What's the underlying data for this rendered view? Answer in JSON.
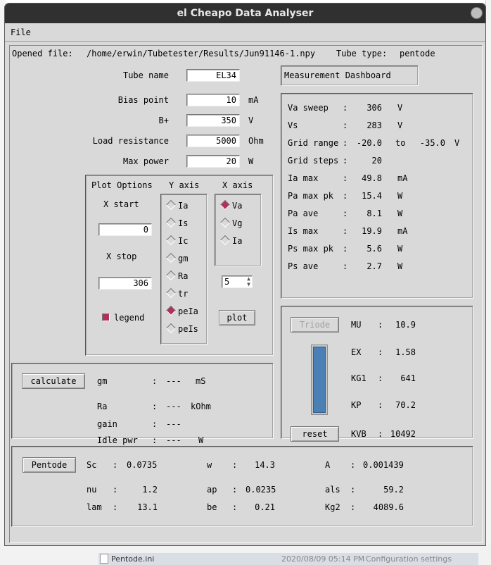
{
  "window": {
    "title": "el Cheapo Data Analyser"
  },
  "menu": {
    "file": "File"
  },
  "header": {
    "opened_label": "Opened file:",
    "opened_path": "/home/erwin/Tubetester/Results/Jun91146-1.npy",
    "tube_type_label": "Tube type:",
    "tube_type": "pentode"
  },
  "params": {
    "tube_name": {
      "label": "Tube name",
      "value": "EL34"
    },
    "bias_point": {
      "label": "Bias point",
      "value": "10",
      "unit": "mA"
    },
    "b_plus": {
      "label": "B+",
      "value": "350",
      "unit": "V"
    },
    "load_resistance": {
      "label": "Load resistance",
      "value": "5000",
      "unit": "Ohm"
    },
    "max_power": {
      "label": "Max power",
      "value": "20",
      "unit": "W"
    }
  },
  "plot_options": {
    "title": "Plot Options",
    "x_start_label": "X start",
    "x_start": "0",
    "x_stop_label": "X stop",
    "x_stop": "306",
    "legend_label": "legend",
    "legend_checked": true,
    "y_axis_label": "Y axis",
    "y_axis_options": [
      "Ia",
      "Is",
      "Ic",
      "gm",
      "Ra",
      "tr",
      "peIa",
      "peIs"
    ],
    "y_axis_selected": "peIa",
    "x_axis_label": "X axis",
    "x_axis_options": [
      "Va",
      "Vg",
      "Ia"
    ],
    "x_axis_selected": "Va",
    "spin_value": "5",
    "plot_button": "plot"
  },
  "dashboard": {
    "title": "Measurement Dashboard",
    "rows": [
      {
        "name": "Va sweep",
        "value": "306",
        "unit": "V"
      },
      {
        "name": "Vs",
        "value": "283",
        "unit": "V"
      },
      {
        "name": "Grid range",
        "value": "-20.0",
        "to": "to",
        "value2": "-35.0",
        "unit": "V"
      },
      {
        "name": "Grid steps",
        "value": "20",
        "unit": ""
      },
      {
        "name": "Ia max",
        "value": "49.8",
        "unit": "mA"
      },
      {
        "name": "Pa max pk",
        "value": "15.4",
        "unit": "W"
      },
      {
        "name": "Pa ave",
        "value": "8.1",
        "unit": "W"
      },
      {
        "name": "Is max",
        "value": "19.9",
        "unit": "mA"
      },
      {
        "name": "Ps max pk",
        "value": "5.6",
        "unit": "W"
      },
      {
        "name": "Ps ave",
        "value": "2.7",
        "unit": "W"
      }
    ]
  },
  "calc": {
    "button": "calculate",
    "rows": [
      {
        "name": "gm",
        "value": "---",
        "unit": "mS"
      },
      {
        "name": "Ra",
        "value": "---",
        "unit": "kOhm"
      },
      {
        "name": "gain",
        "value": "---",
        "unit": ""
      },
      {
        "name": "Idle pwr",
        "value": "---",
        "unit": "W"
      }
    ]
  },
  "triode": {
    "button": "Triode",
    "reset_button": "reset",
    "rows": [
      {
        "name": "MU",
        "value": "10.9"
      },
      {
        "name": "EX",
        "value": "1.58"
      },
      {
        "name": "KG1",
        "value": "641"
      },
      {
        "name": "KP",
        "value": "70.2"
      },
      {
        "name": "KVB",
        "value": "10492"
      }
    ]
  },
  "pentode": {
    "button": "Pentode",
    "params": [
      {
        "name": "Sc",
        "value": "0.0735"
      },
      {
        "name": "w",
        "value": "14.3"
      },
      {
        "name": "A",
        "value": "0.001439"
      },
      {
        "name": "nu",
        "value": "1.2"
      },
      {
        "name": "ap",
        "value": "0.0235"
      },
      {
        "name": "als",
        "value": "59.2"
      },
      {
        "name": "lam",
        "value": "13.1"
      },
      {
        "name": "be",
        "value": "0.21"
      },
      {
        "name": "Kg2",
        "value": "4089.6"
      }
    ]
  },
  "background": {
    "file_name": "Pentode.ini",
    "file_date": "2020/08/09 05:14 PM",
    "file_type": "Configuration settings"
  }
}
